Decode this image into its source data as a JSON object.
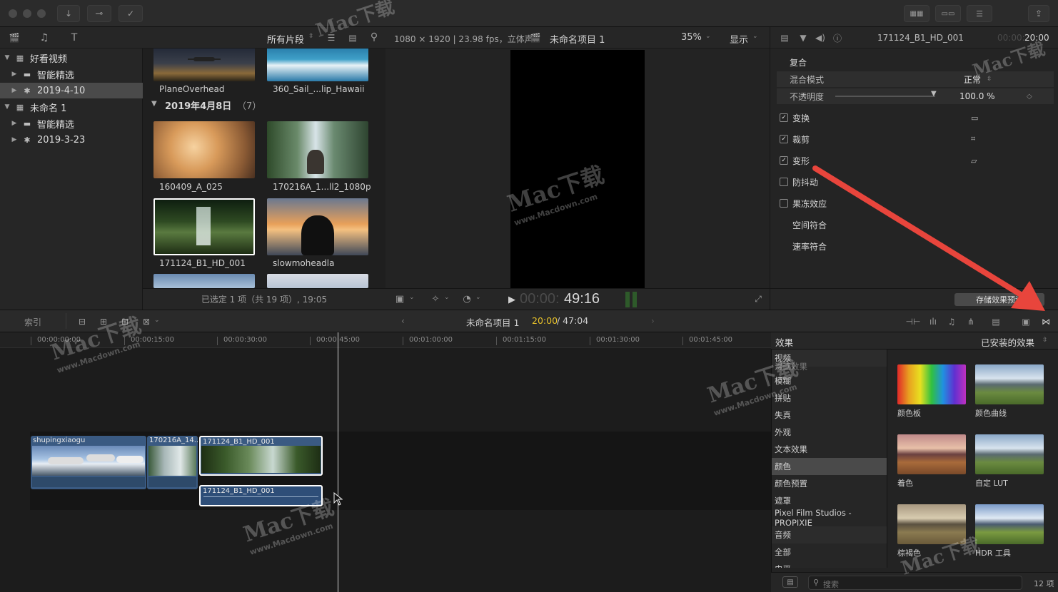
{
  "library": {
    "items": [
      {
        "label": "好看视频",
        "type": "library"
      },
      {
        "label": "智能精选",
        "type": "folder"
      },
      {
        "label": "2019-4-10",
        "type": "event"
      },
      {
        "label": "未命名 1",
        "type": "library"
      },
      {
        "label": "智能精选",
        "type": "folder"
      },
      {
        "label": "2019-3-23",
        "type": "event"
      }
    ]
  },
  "browser": {
    "filter_label": "所有片段",
    "group_header": "2019年4月8日",
    "group_count": "（7）",
    "clips": [
      {
        "name": "PlaneOverhead"
      },
      {
        "name": "360_Sail_...lip_Hawaii"
      },
      {
        "name": "160409_A_025"
      },
      {
        "name": "170216A_1...ll2_1080p"
      },
      {
        "name": "171124_B1_HD_001"
      },
      {
        "name": "slowmoheadla"
      }
    ],
    "footer": "已选定 1 项（共 19 项）, 19:05"
  },
  "viewer": {
    "format": "1080 × 1920 | 23.98 fps，立体声",
    "project_name": "未命名项目 1",
    "zoom": "35%",
    "display_label": "显示",
    "timecode_dim": "00:00:",
    "timecode": "49:16"
  },
  "inspector": {
    "clip_name": "171124_B1_HD_001",
    "timecode_dim": "00:00:",
    "timecode": "20:00",
    "section_composite": "复合",
    "blend_mode_label": "混合模式",
    "blend_mode_value": "正常",
    "opacity_label": "不透明度",
    "opacity_value": "100.0 %",
    "opacity_fraction": 1.0,
    "transform": "变换",
    "crop": "裁剪",
    "distort": "变形",
    "stabilization": "防抖动",
    "freeze": "果冻效应",
    "spatial_conform": "空间符合",
    "rate_conform": "速率符合",
    "save_preset": "存储效果预设"
  },
  "timeline": {
    "index_label": "索引",
    "project_name": "未命名项目 1",
    "position": "20:00",
    "duration": "/ 47:04",
    "ruler": [
      "00:00:00:00",
      "00:00:15:00",
      "00:00:30:00",
      "00:00:45:00",
      "00:01:00:00",
      "00:01:15:00",
      "00:01:30:00",
      "00:01:45:00"
    ],
    "clips": [
      {
        "name": "shupingxiaogu"
      },
      {
        "name": "170216A_14..."
      },
      {
        "name": "171124_B1_HD_001"
      },
      {
        "name": "171124_B1_HD_001"
      }
    ]
  },
  "effects": {
    "title": "效果",
    "installed_label": "已安装的效果",
    "categories": [
      {
        "label": "视频",
        "kind": "hdr"
      },
      {
        "label": "漫画效果",
        "kind": "item"
      },
      {
        "label": "模糊",
        "kind": "item"
      },
      {
        "label": "拼贴",
        "kind": "item"
      },
      {
        "label": "失真",
        "kind": "item"
      },
      {
        "label": "外观",
        "kind": "item"
      },
      {
        "label": "文本效果",
        "kind": "item"
      },
      {
        "label": "颜色",
        "kind": "sel"
      },
      {
        "label": "颜色预置",
        "kind": "item"
      },
      {
        "label": "遮罩",
        "kind": "item"
      },
      {
        "label": "Pixel Film Studios - PROPIXIE",
        "kind": "item"
      },
      {
        "label": "音频",
        "kind": "hdr"
      },
      {
        "label": "全部",
        "kind": "item"
      },
      {
        "label": "电平",
        "kind": "item"
      }
    ],
    "tiles": [
      {
        "label": "颜色板"
      },
      {
        "label": "颜色曲线"
      },
      {
        "label": "着色"
      },
      {
        "label": "自定 LUT"
      },
      {
        "label": "棕褐色"
      },
      {
        "label": "HDR 工具"
      }
    ],
    "search_placeholder": "搜索",
    "count": "12 项"
  },
  "watermark": {
    "brand": "Mac下载",
    "url": "www.Macdown.com"
  },
  "colors": {
    "accent_yellow": "#e8c22a",
    "selection_white": "#ffffff",
    "annotation_arrow": "#e8453c"
  }
}
